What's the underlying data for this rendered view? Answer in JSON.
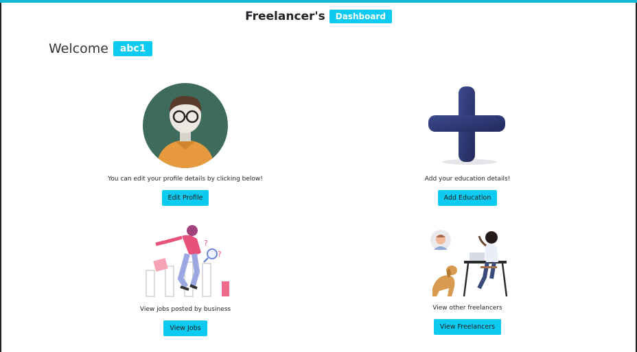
{
  "header": {
    "brand": "Freelancer's",
    "badge": "Dashboard"
  },
  "welcome": {
    "text": "Welcome",
    "username": "abc1"
  },
  "cards": [
    {
      "caption": "You can edit your profile details by clicking below!",
      "button": "Edit Profile",
      "icon": "user-avatar-illustration"
    },
    {
      "caption": "Add your education details!",
      "button": "Add Education",
      "icon": "plus-illustration"
    },
    {
      "caption": "View jobs posted by business",
      "button": "View Jobs",
      "icon": "job-search-illustration"
    },
    {
      "caption": "View other freelancers",
      "button": "View Freelancers",
      "icon": "freelancer-at-desk-illustration"
    }
  ],
  "colors": {
    "accent": "#0dcaf0",
    "topbar": "#17b6d8",
    "avatar_bg": "#3f6b5c",
    "sweater": "#e79a3d",
    "plus": "#2f3a73"
  }
}
